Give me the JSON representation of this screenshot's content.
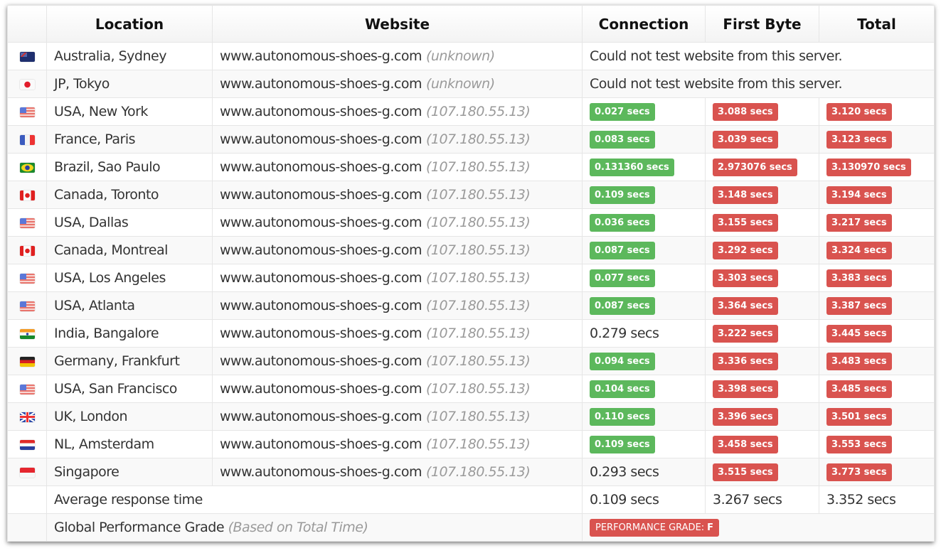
{
  "colors": {
    "good": "#5cb85c",
    "bad": "#d9534f"
  },
  "headers": {
    "flag": "",
    "location": "Location",
    "website": "Website",
    "connection": "Connection",
    "first_byte": "First Byte",
    "total": "Total"
  },
  "rows": [
    {
      "flag": "au",
      "location": "Australia, Sydney",
      "website": "www.autonomous-shoes-g.com",
      "ip": "(unknown)",
      "error": "Could not test website from this server."
    },
    {
      "flag": "jp",
      "location": "JP, Tokyo",
      "website": "www.autonomous-shoes-g.com",
      "ip": "(unknown)",
      "error": "Could not test website from this server."
    },
    {
      "flag": "us",
      "location": "USA, New York",
      "website": "www.autonomous-shoes-g.com",
      "ip": "(107.180.55.13)",
      "connection": "0.027 secs",
      "connection_status": "good",
      "first_byte": "3.088 secs",
      "first_byte_status": "bad",
      "total": "3.120 secs",
      "total_status": "bad"
    },
    {
      "flag": "fr",
      "location": "France, Paris",
      "website": "www.autonomous-shoes-g.com",
      "ip": "(107.180.55.13)",
      "connection": "0.083 secs",
      "connection_status": "good",
      "first_byte": "3.039 secs",
      "first_byte_status": "bad",
      "total": "3.123 secs",
      "total_status": "bad"
    },
    {
      "flag": "br",
      "location": "Brazil, Sao Paulo",
      "website": "www.autonomous-shoes-g.com",
      "ip": "(107.180.55.13)",
      "connection": "0.131360 secs",
      "connection_status": "good",
      "first_byte": "2.973076 secs",
      "first_byte_status": "bad",
      "total": "3.130970 secs",
      "total_status": "bad"
    },
    {
      "flag": "ca",
      "location": "Canada, Toronto",
      "website": "www.autonomous-shoes-g.com",
      "ip": "(107.180.55.13)",
      "connection": "0.109 secs",
      "connection_status": "good",
      "first_byte": "3.148 secs",
      "first_byte_status": "bad",
      "total": "3.194 secs",
      "total_status": "bad"
    },
    {
      "flag": "us",
      "location": "USA, Dallas",
      "website": "www.autonomous-shoes-g.com",
      "ip": "(107.180.55.13)",
      "connection": "0.036 secs",
      "connection_status": "good",
      "first_byte": "3.155 secs",
      "first_byte_status": "bad",
      "total": "3.217 secs",
      "total_status": "bad"
    },
    {
      "flag": "ca",
      "location": "Canada, Montreal",
      "website": "www.autonomous-shoes-g.com",
      "ip": "(107.180.55.13)",
      "connection": "0.087 secs",
      "connection_status": "good",
      "first_byte": "3.292 secs",
      "first_byte_status": "bad",
      "total": "3.324 secs",
      "total_status": "bad"
    },
    {
      "flag": "us",
      "location": "USA, Los Angeles",
      "website": "www.autonomous-shoes-g.com",
      "ip": "(107.180.55.13)",
      "connection": "0.077 secs",
      "connection_status": "good",
      "first_byte": "3.303 secs",
      "first_byte_status": "bad",
      "total": "3.383 secs",
      "total_status": "bad"
    },
    {
      "flag": "us",
      "location": "USA, Atlanta",
      "website": "www.autonomous-shoes-g.com",
      "ip": "(107.180.55.13)",
      "connection": "0.087 secs",
      "connection_status": "good",
      "first_byte": "3.364 secs",
      "first_byte_status": "bad",
      "total": "3.387 secs",
      "total_status": "bad"
    },
    {
      "flag": "in",
      "location": "India, Bangalore",
      "website": "www.autonomous-shoes-g.com",
      "ip": "(107.180.55.13)",
      "connection": "0.279 secs",
      "connection_status": "plain",
      "first_byte": "3.222 secs",
      "first_byte_status": "bad",
      "total": "3.445 secs",
      "total_status": "bad"
    },
    {
      "flag": "de",
      "location": "Germany, Frankfurt",
      "website": "www.autonomous-shoes-g.com",
      "ip": "(107.180.55.13)",
      "connection": "0.094 secs",
      "connection_status": "good",
      "first_byte": "3.336 secs",
      "first_byte_status": "bad",
      "total": "3.483 secs",
      "total_status": "bad"
    },
    {
      "flag": "us",
      "location": "USA, San Francisco",
      "website": "www.autonomous-shoes-g.com",
      "ip": "(107.180.55.13)",
      "connection": "0.104 secs",
      "connection_status": "good",
      "first_byte": "3.398 secs",
      "first_byte_status": "bad",
      "total": "3.485 secs",
      "total_status": "bad"
    },
    {
      "flag": "uk",
      "location": "UK, London",
      "website": "www.autonomous-shoes-g.com",
      "ip": "(107.180.55.13)",
      "connection": "0.110 secs",
      "connection_status": "good",
      "first_byte": "3.396 secs",
      "first_byte_status": "bad",
      "total": "3.501 secs",
      "total_status": "bad"
    },
    {
      "flag": "nl",
      "location": "NL, Amsterdam",
      "website": "www.autonomous-shoes-g.com",
      "ip": "(107.180.55.13)",
      "connection": "0.109 secs",
      "connection_status": "good",
      "first_byte": "3.458 secs",
      "first_byte_status": "bad",
      "total": "3.553 secs",
      "total_status": "bad"
    },
    {
      "flag": "sg",
      "location": "Singapore",
      "website": "www.autonomous-shoes-g.com",
      "ip": "(107.180.55.13)",
      "connection": "0.293 secs",
      "connection_status": "plain",
      "first_byte": "3.515 secs",
      "first_byte_status": "bad",
      "total": "3.773 secs",
      "total_status": "bad"
    }
  ],
  "average": {
    "label": "Average response time",
    "connection": "0.109 secs",
    "first_byte": "3.267 secs",
    "total": "3.352 secs"
  },
  "grade": {
    "label": "Global Performance Grade",
    "note": "(Based on Total Time)",
    "badge_label": "PERFORMANCE GRADE:",
    "badge_value": "F"
  }
}
